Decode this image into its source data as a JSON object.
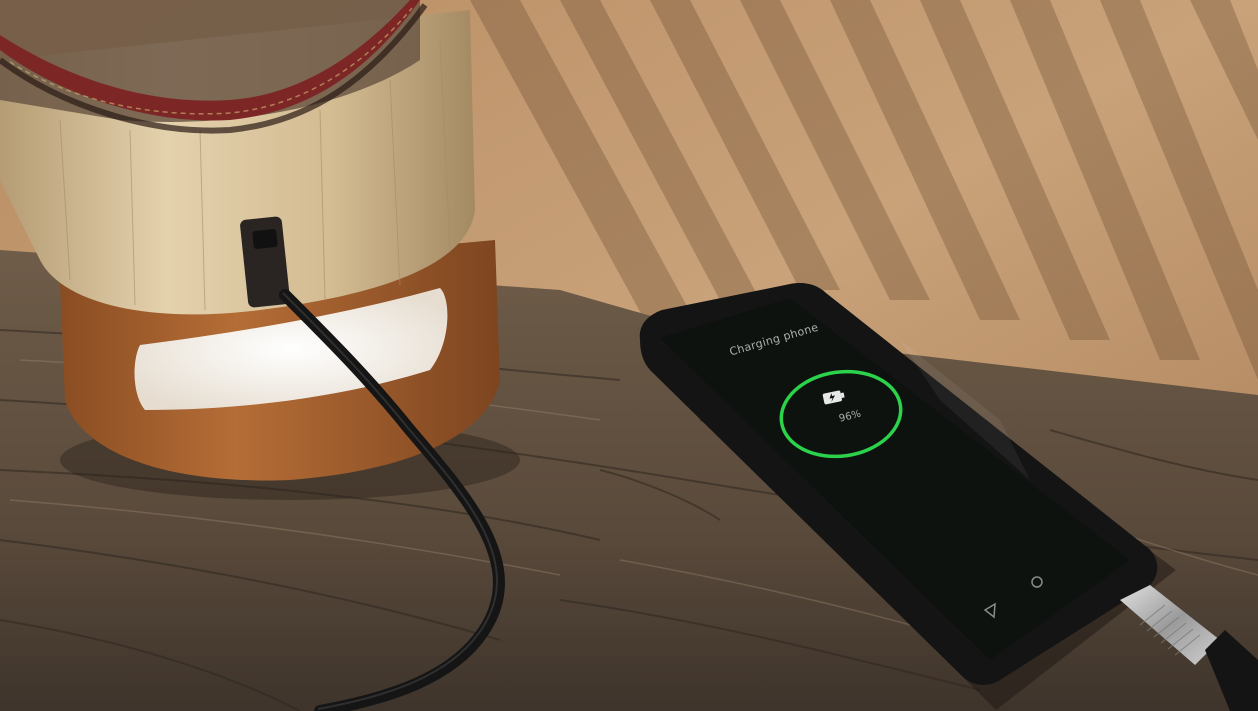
{
  "scene": {
    "description_kind": "photograph",
    "colors": {
      "sand": "#c9a27a",
      "sand_shadow": "#7a583b",
      "wood_table": "#6b5846",
      "wood_table_dark": "#3b3128",
      "lamp_bamboo": "#d8c39c",
      "lamp_base": "#a6622f",
      "lamp_light": "#efeae2",
      "strap_red": "#8a2a2a",
      "phone_body": "#151515",
      "screen": "#0e1210",
      "ring_green": "#2bd24a",
      "cable": "#1a1a1a",
      "plug_metal": "#b9b9b9"
    },
    "icons": [
      "battery-charging-icon",
      "nav-back-icon",
      "nav-home-icon"
    ]
  },
  "phone": {
    "status_text": "Charging phone",
    "battery_percent": "96%",
    "charge_level": 0.96
  }
}
